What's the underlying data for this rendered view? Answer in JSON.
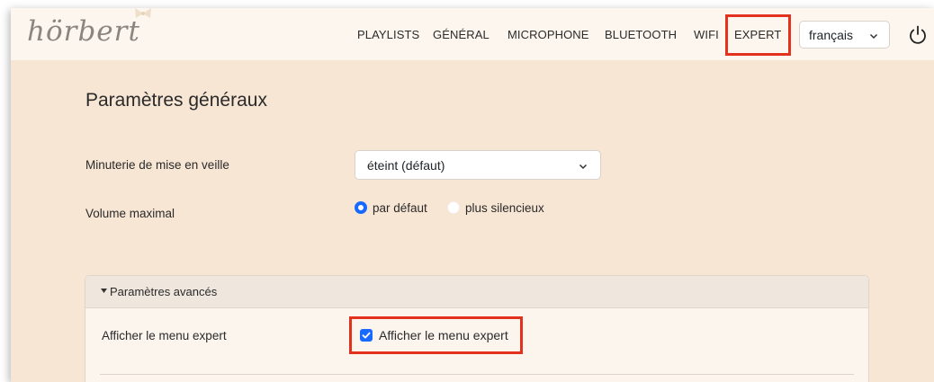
{
  "brand": {
    "logo_text": "hörbert"
  },
  "nav": {
    "items": [
      {
        "label": "PLAYLISTS"
      },
      {
        "label": "GÉNÉRAL"
      },
      {
        "label": "MICROPHONE"
      },
      {
        "label": "BLUETOOTH"
      },
      {
        "label": "WIFI"
      },
      {
        "label": "EXPERT"
      }
    ],
    "language": {
      "selected": "français"
    }
  },
  "page": {
    "title": "Paramètres généraux"
  },
  "settings": {
    "sleep_timer": {
      "label": "Minuterie de mise en veille",
      "selected": "éteint (défaut)"
    },
    "max_volume": {
      "label": "Volume maximal",
      "options": [
        {
          "label": "par défaut",
          "selected": true
        },
        {
          "label": "plus silencieux",
          "selected": false
        }
      ]
    }
  },
  "advanced": {
    "header": "Paramètres avancés",
    "show_expert": {
      "label": "Afficher le menu expert",
      "checkbox_label": "Afficher le menu expert",
      "checked": true
    }
  },
  "colors": {
    "accent": "#1769ff",
    "highlight": "#e3311d",
    "background": "#f8e6d5",
    "navbar": "#fcf6ef"
  },
  "icons": {
    "logo_decoration": "bow-icon",
    "language_dropdown": "chevron-down-icon",
    "power": "power-icon",
    "sleep_dropdown": "chevron-down-icon",
    "collapse": "caret-down-icon",
    "checkbox": "checkmark-icon"
  }
}
